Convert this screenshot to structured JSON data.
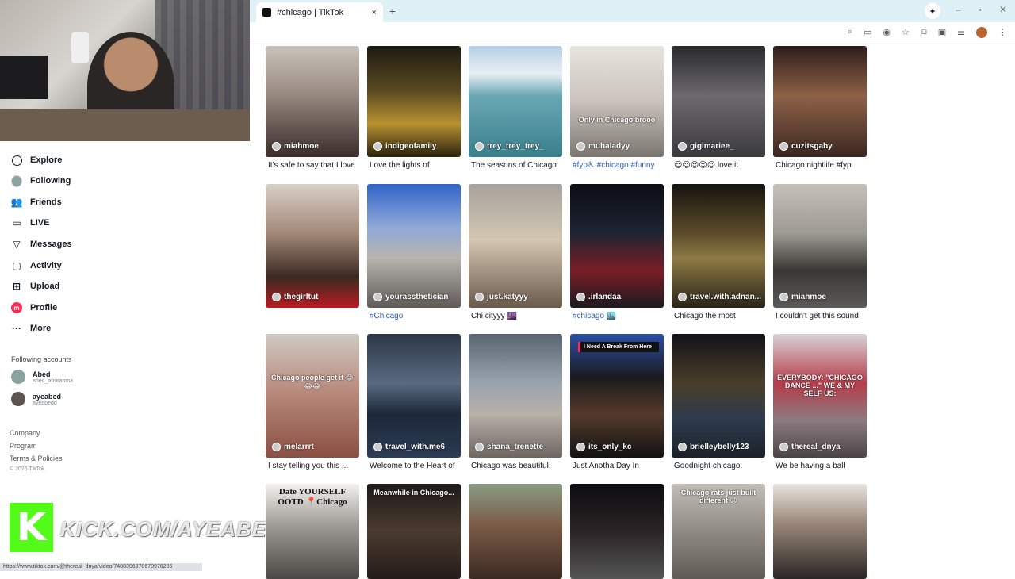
{
  "browser": {
    "tab_title": "#chicago | TikTok",
    "close_glyph": "×",
    "newtab_glyph": "+",
    "status_url": "https://www.tiktok.com/@thereal_dnya/video/7488396378670976286"
  },
  "sidebar": {
    "nav": [
      {
        "label": "Explore",
        "icon": "compass-icon"
      },
      {
        "label": "Following",
        "icon": "following-avatar-icon"
      },
      {
        "label": "Friends",
        "icon": "friends-icon"
      },
      {
        "label": "LIVE",
        "icon": "live-icon"
      },
      {
        "label": "Messages",
        "icon": "messages-icon"
      },
      {
        "label": "Activity",
        "icon": "activity-icon"
      },
      {
        "label": "Upload",
        "icon": "upload-icon"
      },
      {
        "label": "Profile",
        "icon": "profile-icon"
      },
      {
        "label": "More",
        "icon": "more-icon"
      }
    ],
    "following_label": "Following accounts",
    "accounts": [
      {
        "name": "Abed",
        "handle": "abed_aburahma"
      },
      {
        "name": "ayeabed",
        "handle": "ayeabedd"
      }
    ],
    "footer": [
      "Company",
      "Program",
      "Terms & Policies"
    ],
    "copyright": "© 2026 TikTok"
  },
  "overlay": {
    "kick_letter": "K",
    "kick_text": "KICK.COM/AYEABED"
  },
  "videos": [
    {
      "user": "miahmoe",
      "desc": "It's safe to say that I love",
      "overlay": "",
      "tag": false,
      "bg": "linear-gradient(180deg,#c9c2bb 0%,#9c8f86 40%,#3a2d2a 100%)"
    },
    {
      "user": "indigeofamily",
      "desc": "Love the lights of",
      "overlay": "",
      "tag": false,
      "bg": "linear-gradient(180deg,#1c1a12 0%,#5a4a22 40%,#b8902f 70%,#2a220f 100%)"
    },
    {
      "user": "trey_trey_trey_",
      "desc": "The seasons of Chicago",
      "overlay": "",
      "tag": false,
      "bg": "linear-gradient(180deg,#b7cfe6 0%,#e7eef3 25%,#6aa7b4 45%,#3a7f8c 100%)"
    },
    {
      "user": "muhaladyy",
      "desc": "#fyp♿ #chicago #funny",
      "overlay": "Only in Chicago brooo",
      "tag": true,
      "bg": "linear-gradient(180deg,#e8e4df 0%,#c9c3bb 50%,#7b7570 100%)"
    },
    {
      "user": "gigimariee_",
      "desc": "😍😍😍😍😍 love it",
      "overlay": "",
      "tag": false,
      "bg": "linear-gradient(180deg,#2a2a2d 0%,#6c6a6d 45%,#3b3a3c 100%)"
    },
    {
      "user": "cuzitsgaby",
      "desc": "Chicago nightlife #fyp",
      "overlay": "",
      "tag": false,
      "bg": "linear-gradient(180deg,#2d1d19 0%,#8e6148 45%,#3b2721 100%)"
    },
    {
      "user": "thegirltut",
      "desc": "",
      "overlay": "",
      "tag": false,
      "bg": "linear-gradient(180deg,#d7cfc6 0%,#a28877 40%,#3b2a22 75%,#b71b22 100%)"
    },
    {
      "user": "yourassthetician",
      "desc": "#Chicago",
      "overlay": "",
      "tag": true,
      "bg": "linear-gradient(180deg,#3163c9 0%,#8fa9d8 35%,#b7b4af 60%,#5f5a55 100%)"
    },
    {
      "user": "just.katyyy",
      "desc": "Chi cityyy 🌆",
      "overlay": "",
      "tag": false,
      "bg": "linear-gradient(180deg,#a5a29d 0%,#d4c6b2 45%,#6b5a4c 100%)"
    },
    {
      "user": ".irlandaa",
      "desc": "#chicago 🏙️",
      "overlay": "",
      "tag": true,
      "bg": "linear-gradient(180deg,#0b0d16 0%,#1f2432 40%,#7a1d26 70%,#1b1b1f 100%)"
    },
    {
      "user": "travel.with.adnan...",
      "desc": "Chicago the most",
      "overlay": "",
      "tag": false,
      "bg": "linear-gradient(180deg,#15140f 0%,#5c4b2b 40%,#8d7a45 60%,#2a2419 100%)"
    },
    {
      "user": "miahmoe",
      "desc": "I couldn't get this sound",
      "overlay": "",
      "tag": false,
      "bg": "linear-gradient(180deg,#c6c0b9 0%,#9d9993 40%,#3a3633 70%,#5b5a58 100%)"
    },
    {
      "user": "melarrrt",
      "desc": "I stay telling you this ...",
      "overlay": "Chicago people get it 😂😂😂",
      "tag": false,
      "bg": "linear-gradient(180deg,#cfc9c4 0%,#b98c7e 45%,#8a4f43 100%)"
    },
    {
      "user": "travel_with.me6",
      "desc": "Welcome to the Heart of",
      "overlay": "",
      "tag": false,
      "bg": "linear-gradient(180deg,#2c3646 0%,#5a6b80 40%,#1c2738 65%,#2c3c54 100%)"
    },
    {
      "user": "shana_trenette",
      "desc": "Chicago was beautiful.",
      "overlay": "",
      "tag": false,
      "bg": "linear-gradient(180deg,#5a6470 0%,#9aa4ae 40%,#b7b0a8 65%,#6d655e 100%)"
    },
    {
      "user": "its_only_kc",
      "desc": "Just Anotha Day In",
      "overlay": "",
      "badge": "I Need A Break From Here",
      "tag": false,
      "bg": "linear-gradient(180deg,#2b4fa8 0%,#1a1a1c 35%,#553a2c 65%,#121212 100%)"
    },
    {
      "user": "brielleybelly123",
      "desc": "Goodnight chicago.",
      "overlay": "",
      "tag": false,
      "bg": "linear-gradient(180deg,#111218 0%,#4a3e2a 40%,#2d3a4d 70%,#1c2129 100%)"
    },
    {
      "user": "thereal_dnya",
      "desc": "We be having a ball",
      "overlay": "EVERYBODY: \"CHICAGO DANCE ...\" WE & MY SELF US:",
      "tag": false,
      "bg": "linear-gradient(180deg,#d8d3d5 0%,#b63d4b 40%,#8c7b80 70%,#4a4447 100%)"
    },
    {
      "user": "",
      "desc": "",
      "overlay": "Date YOURSELF OOTD 📍Chicago",
      "dark": true,
      "tag": false,
      "bg": "linear-gradient(180deg,#f3f1ee 0%,#9c9893 45%,#4b4744 100%)"
    },
    {
      "user": "",
      "desc": "",
      "overlay": "Meanwhile in Chicago...",
      "tag": false,
      "bg": "linear-gradient(180deg,#1d1a1a 0%,#4b3a2f 50%,#231c18 100%)"
    },
    {
      "user": "",
      "desc": "",
      "overlay": "",
      "tag": false,
      "bg": "linear-gradient(180deg,#8a9b84 0%,#7a5a46 45%,#3a2a22 100%)"
    },
    {
      "user": "",
      "desc": "",
      "overlay": "",
      "tag": false,
      "bg": "linear-gradient(180deg,#0c0c0e 0%,#2a2426 50%,#555 100%)"
    },
    {
      "user": "",
      "desc": "",
      "overlay": "Chicago rats just built different 😩",
      "tag": false,
      "bg": "linear-gradient(180deg,#c2beb7 0%,#8f8a83 50%,#5f5a55 100%)"
    },
    {
      "user": "",
      "desc": "",
      "overlay": "",
      "tag": false,
      "bg": "linear-gradient(180deg,#e8e4df 0%,#9e8a7c 40%,#2a2624 100%)"
    }
  ]
}
